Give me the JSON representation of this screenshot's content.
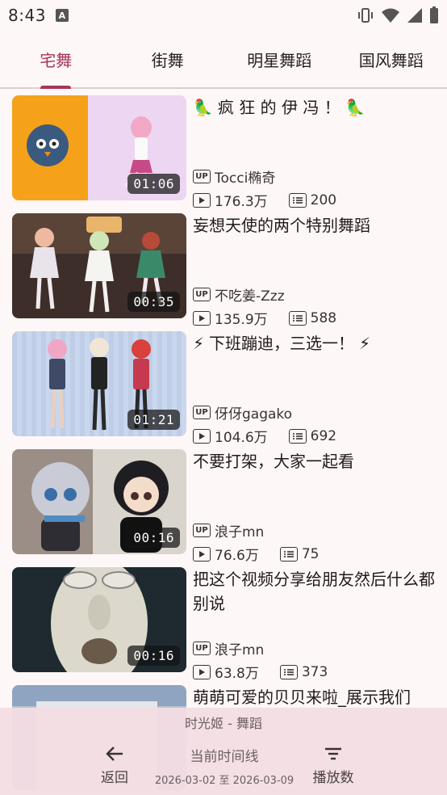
{
  "status_bar": {
    "time": "8:43",
    "icons": [
      "text-a-icon",
      "vibrate-icon",
      "wifi-icon",
      "signal-icon",
      "battery-icon"
    ]
  },
  "tabs": [
    {
      "label": "宅舞",
      "active": true
    },
    {
      "label": "街舞",
      "active": false
    },
    {
      "label": "明星舞蹈",
      "active": false
    },
    {
      "label": "国风舞蹈",
      "active": false
    }
  ],
  "videos": [
    {
      "title": "疯 狂 的 伊 冯 ！",
      "title_emoji": "🦜",
      "duration": "01:06",
      "uploader": "Tocci椭奇",
      "views": "176.3万",
      "comments": "200"
    },
    {
      "title": "妄想天使的两个特别舞蹈",
      "duration": "00:35",
      "uploader": "不吃姜-Zzz",
      "views": "135.9万",
      "comments": "588"
    },
    {
      "title": "下班蹦迪，三选一！",
      "title_emoji": "⚡",
      "duration": "01:21",
      "uploader": "伢伢gagako",
      "views": "104.6万",
      "comments": "692"
    },
    {
      "title": "不要打架，大家一起看",
      "duration": "00:16",
      "uploader": "浪子mn",
      "views": "76.6万",
      "comments": "75"
    },
    {
      "title": "把这个视频分享给朋友然后什么都别说",
      "duration": "00:16",
      "uploader": "浪子mn",
      "views": "63.8万",
      "comments": "373"
    },
    {
      "title": "萌萌可爱的贝贝来啦_展示我们"
    }
  ],
  "bottom_bar": {
    "title": "时光姬 - 舞蹈",
    "back_label": "返回",
    "timeline_label": "当前时间线",
    "timeline_range": "2026-03-02 至 2026-03-09",
    "sort_label": "播放数"
  },
  "badges": {
    "uploader": "UP"
  },
  "colors": {
    "accent": "#a6355c",
    "background": "#fdf7f7",
    "bottom_bar": "#f3dde2"
  }
}
